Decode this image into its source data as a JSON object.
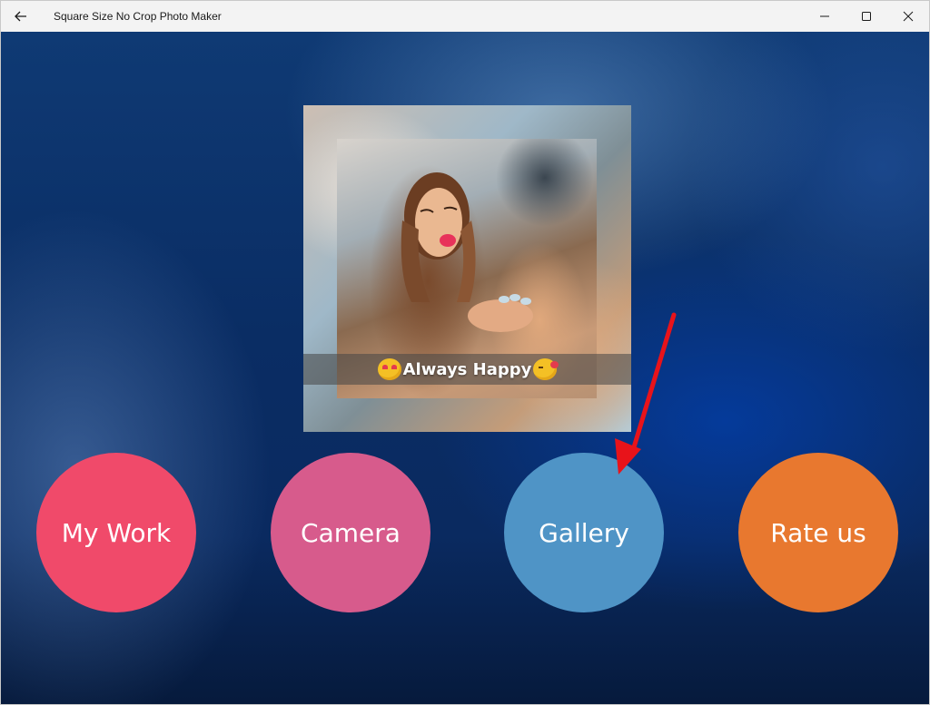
{
  "window": {
    "title": "Square Size No Crop Photo Maker",
    "back_icon": "back-arrow-icon",
    "controls": [
      "minimize-icon",
      "maximize-icon",
      "close-icon"
    ]
  },
  "preview": {
    "caption": "Always Happy"
  },
  "buttons": [
    {
      "label": "My Work",
      "color": "#f04a6a"
    },
    {
      "label": "Camera",
      "color": "#d75b8c"
    },
    {
      "label": "Gallery",
      "color": "#4f94c6"
    },
    {
      "label": "Rate us",
      "color": "#e8782f"
    }
  ],
  "annotation": {
    "arrow_color": "#e8131a"
  }
}
